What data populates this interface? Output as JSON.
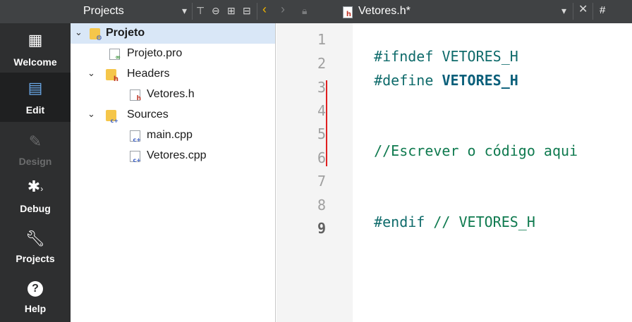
{
  "toolbar": {
    "projects_title": "Projects",
    "file_title": "Vetores.h*",
    "hash_label": "#"
  },
  "modes": [
    {
      "label": "Welcome",
      "icon": "grid-icon"
    },
    {
      "label": "Edit",
      "icon": "document-icon"
    },
    {
      "label": "Design",
      "icon": "pencil-icon"
    },
    {
      "label": "Debug",
      "icon": "bug-icon"
    },
    {
      "label": "Projects",
      "icon": "wrench-icon"
    },
    {
      "label": "Help",
      "icon": "question-icon"
    }
  ],
  "tree": {
    "project": "Projeto",
    "pro_file": "Projeto.pro",
    "headers": "Headers",
    "header_file": "Vetores.h",
    "sources": "Sources",
    "source_main": "main.cpp",
    "source_vetores": "Vetores.cpp"
  },
  "editor": {
    "line_numbers": [
      "1",
      "2",
      "3",
      "4",
      "5",
      "6",
      "7",
      "8",
      "9"
    ],
    "line1_directive": "#ifndef",
    "line1_macro": "VETORES_H",
    "line2_directive": "#define",
    "line2_macro": "VETORES_H",
    "line5_comment": "//Escrever o código aqui",
    "line8_directive": "#endif",
    "line8_comment": "// VETORES_H",
    "current_line": 9
  },
  "colors": {
    "sidebar_bg": "#2e2f30",
    "toolbar_bg": "#404244",
    "selection": "#d9e7f7",
    "change_marker": "#e02020",
    "comment": "#0f7a4f",
    "directive": "#0f6b6b"
  }
}
